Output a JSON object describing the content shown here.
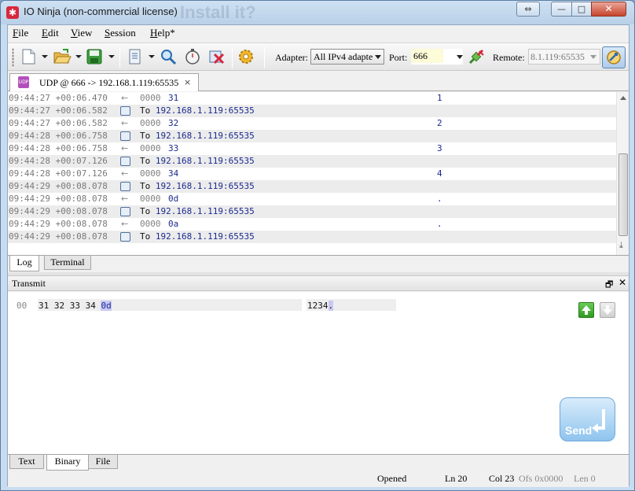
{
  "window": {
    "title": "IO Ninja (non-commercial license)",
    "ghost_text": "Install it?",
    "buttons": {
      "restore_tab": "⇔",
      "minimize": "—",
      "maximize": "□",
      "close": "✕"
    }
  },
  "menu": {
    "items": [
      {
        "label": "File",
        "accel": "F",
        "rest": "ile"
      },
      {
        "label": "Edit",
        "accel": "E",
        "rest": "dit"
      },
      {
        "label": "View",
        "accel": "V",
        "rest": "iew"
      },
      {
        "label": "Session",
        "accel": "S",
        "rest": "ession"
      },
      {
        "label": "Help*",
        "accel": "H",
        "rest": "elp*"
      }
    ]
  },
  "toolbar": {
    "icons": [
      "new-session-icon",
      "open-icon",
      "save-icon",
      "session-settings-icon",
      "find-icon",
      "stopwatch-icon",
      "clear-log-icon",
      "settings-gear-icon"
    ],
    "adapter_label": "Adapter:",
    "adapter_value": "All IPv4 adapte",
    "port_label": "Port:",
    "port_value": "666",
    "remote_label": "Remote:",
    "remote_value": "8.1.119:65535"
  },
  "session_tab": {
    "icon": "udp-icon",
    "icon_text": "UDP",
    "label": "UDP @ 666 -> 192.168.1.119:65535",
    "close": "×"
  },
  "log": {
    "rows": [
      {
        "kind": "data",
        "ts": "09:44:27 +00:06.470",
        "dir": "←",
        "offset": "0000",
        "hex": "31",
        "ascii": "1"
      },
      {
        "kind": "to",
        "ts": "09:44:27 +00:06.582",
        "to": "To",
        "addr": "192.168.1.119:65535"
      },
      {
        "kind": "data",
        "ts": "09:44:27 +00:06.582",
        "dir": "←",
        "offset": "0000",
        "hex": "32",
        "ascii": "2"
      },
      {
        "kind": "to",
        "ts": "09:44:28 +00:06.758",
        "to": "To",
        "addr": "192.168.1.119:65535"
      },
      {
        "kind": "data",
        "ts": "09:44:28 +00:06.758",
        "dir": "←",
        "offset": "0000",
        "hex": "33",
        "ascii": "3"
      },
      {
        "kind": "to",
        "ts": "09:44:28 +00:07.126",
        "to": "To",
        "addr": "192.168.1.119:65535"
      },
      {
        "kind": "data",
        "ts": "09:44:28 +00:07.126",
        "dir": "←",
        "offset": "0000",
        "hex": "34",
        "ascii": "4"
      },
      {
        "kind": "to",
        "ts": "09:44:29 +00:08.078",
        "to": "To",
        "addr": "192.168.1.119:65535"
      },
      {
        "kind": "data",
        "ts": "09:44:29 +00:08.078",
        "dir": "←",
        "offset": "0000",
        "hex": "0d",
        "ascii": "."
      },
      {
        "kind": "to",
        "ts": "09:44:29 +00:08.078",
        "to": "To",
        "addr": "192.168.1.119:65535"
      },
      {
        "kind": "data",
        "ts": "09:44:29 +00:08.078",
        "dir": "←",
        "offset": "0000",
        "hex": "0a",
        "ascii": "."
      },
      {
        "kind": "to",
        "ts": "09:44:29 +00:08.078",
        "to": "To",
        "addr": "192.168.1.119:65535"
      }
    ],
    "scroll_down_glyph": "⤓"
  },
  "log_tabs": {
    "log": "Log",
    "terminal": "Terminal"
  },
  "transmit": {
    "title": "Transmit",
    "float_glyph": "🗗",
    "close_glyph": "✕",
    "offset": "00",
    "hex_plain": "31 32 33 34 ",
    "hex_selected": "0d",
    "ascii_plain": "1234",
    "ascii_selected": ".",
    "send_label": "Send"
  },
  "tx_tabs": {
    "text": "Text",
    "binary": "Binary",
    "file": "File"
  },
  "status": {
    "state": "Opened",
    "line": "Ln 20",
    "col": "Col 23",
    "ofs": "Ofs 0x0000",
    "len": "Len 0"
  }
}
